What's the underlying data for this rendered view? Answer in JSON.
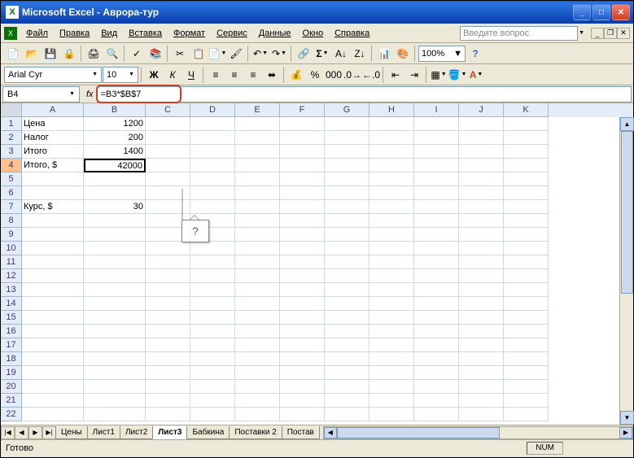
{
  "title": "Microsoft Excel - Аврора-тур",
  "menu": [
    "Файл",
    "Правка",
    "Вид",
    "Вставка",
    "Формат",
    "Сервис",
    "Данные",
    "Окно",
    "Справка"
  ],
  "question_placeholder": "Введите вопрос",
  "zoom": "100%",
  "font_name": "Arial Cyr",
  "font_size": "10",
  "namebox": "B4",
  "formula": "=B3*$B$7",
  "callout": "?",
  "columns": [
    "A",
    "B",
    "C",
    "D",
    "E",
    "F",
    "G",
    "H",
    "I",
    "J",
    "K"
  ],
  "rows": {
    "1": {
      "A": "Цена",
      "B": "1200"
    },
    "2": {
      "A": "Налог",
      "B": "200"
    },
    "3": {
      "A": "Итого",
      "B": "1400"
    },
    "4": {
      "A": "Итого, $",
      "B": "42000"
    },
    "7": {
      "A": "Курс, $",
      "B": "30"
    }
  },
  "active_cell": "B4",
  "sheets": [
    "Цены",
    "Лист1",
    "Лист2",
    "Лист3",
    "Бабкина",
    "Поставки 2",
    "Постав"
  ],
  "active_sheet": "Лист3",
  "status": "Готово",
  "status_num": "NUM"
}
